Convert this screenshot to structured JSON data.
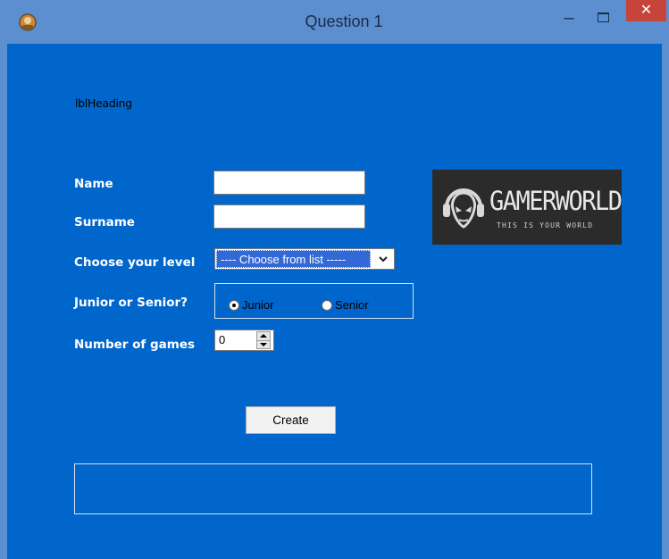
{
  "window": {
    "title": "Question 1"
  },
  "titlebar": {
    "minimize": "–",
    "close": "✕"
  },
  "form": {
    "heading": "lblHeading",
    "name_label": "Name",
    "name_value": "",
    "surname_label": "Surname",
    "surname_value": "",
    "level_label": "Choose your level",
    "level_selected": "---- Choose from list -----",
    "junior_senior_label": "Junior or Senior?",
    "radio_junior": "Junior",
    "radio_senior": "Senior",
    "radio_selected": "Junior",
    "games_label": "Number of games",
    "games_value": "0",
    "create_button": "Create",
    "output_text": ""
  },
  "logo": {
    "title": "GAMERWORLD",
    "tagline": "THIS IS YOUR WORLD"
  },
  "colors": {
    "titlebar": "#5b8fd0",
    "form_background": "#0066cc",
    "close_button": "#c7443a",
    "logo_background": "#2b2b2b"
  },
  "icons": {
    "app": "app-icon",
    "minimize": "minimize-icon",
    "maximize": "maximize-icon",
    "close": "close-icon",
    "dropdown": "chevron-down-icon",
    "spin_up": "arrow-up-icon",
    "spin_down": "arrow-down-icon",
    "logo_emblem": "alien-headphones-icon"
  }
}
